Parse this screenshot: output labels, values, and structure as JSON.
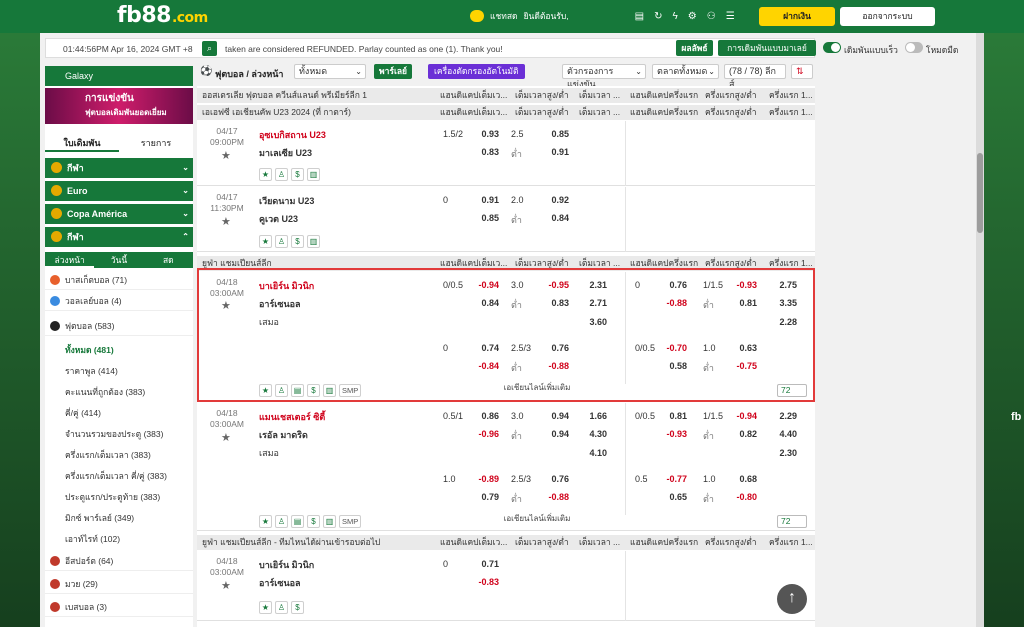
{
  "header": {
    "logo": "fb88",
    "logo_suffix": ".com",
    "chat": "แชทสด",
    "balance_label": "ยินดีต้อนรับ,",
    "deposit": "ฝากเงิน",
    "logout": "ออกจากระบบ"
  },
  "status": {
    "clock": "01:44:56PM Apr 16, 2024 GMT +8",
    "ticker": "taken are considered REFUNDED. Parlay counted as one (1). Thank you!",
    "parlay_btn": "ผลลัพธ์",
    "bettype": "การเดิมพันแบบมาเลย์",
    "toggle1": "เดิมพันแบบเร็ว",
    "toggle2": "โหมดมืด"
  },
  "sidebar": {
    "galaxy": "Galaxy",
    "promo": "การแข่งขัน",
    "promo2": "ฟุตบอลเดิมพันยอดเยี่ยม",
    "tab1": "ใบเดิมพัน",
    "tab2": "รายการ",
    "cats": [
      "กีฬา",
      "Euro",
      "Copa América",
      "กีฬา"
    ],
    "subtabs": [
      "ล่วงหน้า",
      "วันนี้",
      "สด"
    ],
    "sports": [
      {
        "label": "บาสเก็ตบอล (71)",
        "color": "#e8602c"
      },
      {
        "label": "วอลเลย์บอล (4)",
        "color": "#3a8be0"
      },
      {
        "label": "ฟุตบอล (583)",
        "color": "#222"
      }
    ],
    "subs": [
      "ทั้งหมด (481)",
      "ราคาพูล (414)",
      "คะแนนที่ถูกต้อง (383)",
      "คี่/คู่ (414)",
      "จำนวนรวมของประตู (383)",
      "ครึ่งแรก/เต็มเวลา (383)",
      "ครึ่งแรก/เต็มเวลา คี่/คู่ (383)",
      "ประตูแรก/ประตูท้าย (383)",
      "มิกซ์ พาร์เลย์ (349)",
      "เอาท์ไรท์ (102)"
    ],
    "sports2": [
      {
        "label": "อีสปอร์ต (64)",
        "color": "#c0392b"
      },
      {
        "label": "มวย (29)",
        "color": "#c0392b"
      },
      {
        "label": "เบสบอล (3)",
        "color": "#c0392b"
      }
    ]
  },
  "filters": {
    "sport": "ฟุตบอล / ล่วงหน้า",
    "all": "ทั้งหมด",
    "parlay": "พาร์เลย์",
    "cutter": "เครื่องตัดกรองอัตโนมัติ",
    "sort": "ตัวกรองการแข่งขัน",
    "market": "ตลาดทั้งหมด",
    "count": "(78 / 78) ลีกส์"
  },
  "leagues": [
    {
      "name": "ออสเตรเลีย ฟุตบอล ควีนส์แลนด์ พรีเมียร์ลีก 1"
    },
    {
      "name": "เอเอฟซี เอเชียนคัพ U23 2024 (ที่ กาตาร์)"
    },
    {
      "name": "ยูฟ่า แชมเปียนส์ลีก"
    },
    {
      "name": "ยูฟ่า แชมเปียนส์ลีก - ทีมไหนได้ผ่านเข้ารอบต่อไป"
    }
  ],
  "cols": [
    "แฮนดิแคปเต็มเว...",
    "เต็มเวลาสูง/ต่ำ",
    "เต็มเวลา ...",
    "แฮนดิแคปครึ่งแรก",
    "ครึ่งแรกสูง/ต่ำ",
    "ครึ่งแรก 1..."
  ],
  "matches": [
    {
      "date": "04/17",
      "time": "09:00PM",
      "home": "อุซเบกิสถาน U23",
      "away": "มาเลเซีย U23",
      "hcp": "1.5/2",
      "h1": "0.93",
      "h2": "0.83",
      "ou": "2.5",
      "o1": "0.85",
      "o2": "0.91",
      "ulbl": "ต่ำ"
    },
    {
      "date": "04/17",
      "time": "11:30PM",
      "home": "เวียดนาม U23",
      "away": "คูเวต U23",
      "hcp": "0",
      "h1": "0.91",
      "h2": "0.85",
      "ou": "2.0",
      "o1": "0.92",
      "o2": "0.84",
      "ulbl": "ต่ำ"
    },
    {
      "date": "04/18",
      "time": "03:00AM",
      "home": "บาเยิร์น มิวนิก",
      "away": "อาร์เซนอล",
      "draw": "เสมอ",
      "hcp": "0/0.5",
      "h1": "-0.94",
      "h2": "0.84",
      "ou": "3.0",
      "o1": "-0.95",
      "o2": "0.83",
      "ulbl": "ต่ำ",
      "x1": "2.31",
      "x2": "2.71",
      "x3": "3.60",
      "fh_hcp": "0",
      "fh1": "0.76",
      "fh2": "-0.88",
      "fo": "1/1.5",
      "fo1": "-0.93",
      "fo2": "0.81",
      "fx1": "2.75",
      "fx2": "3.35",
      "fx3": "2.28",
      "b_hcp": "0",
      "b1": "0.74",
      "b2": "-0.84",
      "b_ou": "2.5/3",
      "bo1": "0.76",
      "bo2": "-0.88",
      "bf_hcp": "0/0.5",
      "bf1": "-0.70",
      "bf2": "0.58",
      "bfo": "1.0",
      "bfo1": "0.63",
      "bfo2": "-0.75",
      "more": "เอเชียนไลน์เพิ่มเติม",
      "count": "72"
    },
    {
      "date": "04/18",
      "time": "03:00AM",
      "home": "แมนเชสเตอร์ ซิตี้",
      "away": "เรอัล มาดริด",
      "draw": "เสมอ",
      "hcp": "0.5/1",
      "h1": "0.86",
      "h2": "-0.96",
      "ou": "3.0",
      "o1": "0.94",
      "o2": "0.94",
      "ulbl": "ต่ำ",
      "x1": "1.66",
      "x2": "4.30",
      "x3": "4.10",
      "fh_hcp": "0/0.5",
      "fh1": "0.81",
      "fh2": "-0.93",
      "fo": "1/1.5",
      "fo1": "-0.94",
      "fo2": "0.82",
      "fx1": "2.29",
      "fx2": "4.40",
      "fx3": "2.30",
      "b_hcp": "1.0",
      "b1": "-0.89",
      "b2": "0.79",
      "b_ou": "2.5/3",
      "bo1": "0.76",
      "bo2": "-0.88",
      "bf_hcp": "0.5",
      "bf1": "-0.77",
      "bf2": "0.65",
      "bfo": "1.0",
      "bfo1": "0.68",
      "bfo2": "-0.80",
      "more": "เอเชียนไลน์เพิ่มเติม",
      "count": "72"
    },
    {
      "date": "04/18",
      "time": "03:00AM",
      "home": "บาเยิร์น มิวนิก",
      "away": "อาร์เซนอล",
      "hcp": "0",
      "h1": "0.71",
      "h2": "-0.83"
    }
  ],
  "gotop": "↑"
}
